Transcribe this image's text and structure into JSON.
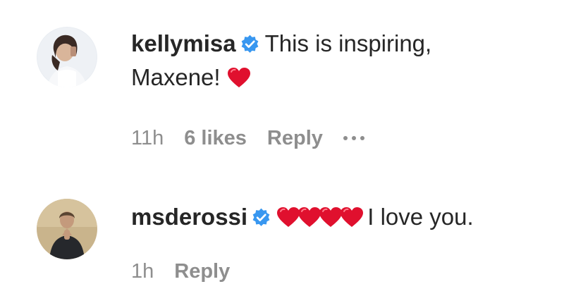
{
  "comments": [
    {
      "username": "kellymisa",
      "verified": true,
      "text_line1": "This is inspiring,",
      "text_line2": "Maxene!",
      "emoji_icon": "red-heart-icon",
      "time": "11h",
      "likes": "6 likes",
      "reply_label": "Reply",
      "more_icon": "ellipsis-icon"
    },
    {
      "username": "msderossi",
      "verified": true,
      "emoji_icons": [
        "red-heart-icon",
        "red-heart-icon",
        "red-heart-icon",
        "red-heart-icon"
      ],
      "text": "I love you.",
      "time": "1h",
      "reply_label": "Reply"
    }
  ],
  "colors": {
    "text": "#262626",
    "meta": "#8e8e8e",
    "verified_blue": "#3897f0",
    "heart_red": "#e0102e"
  }
}
